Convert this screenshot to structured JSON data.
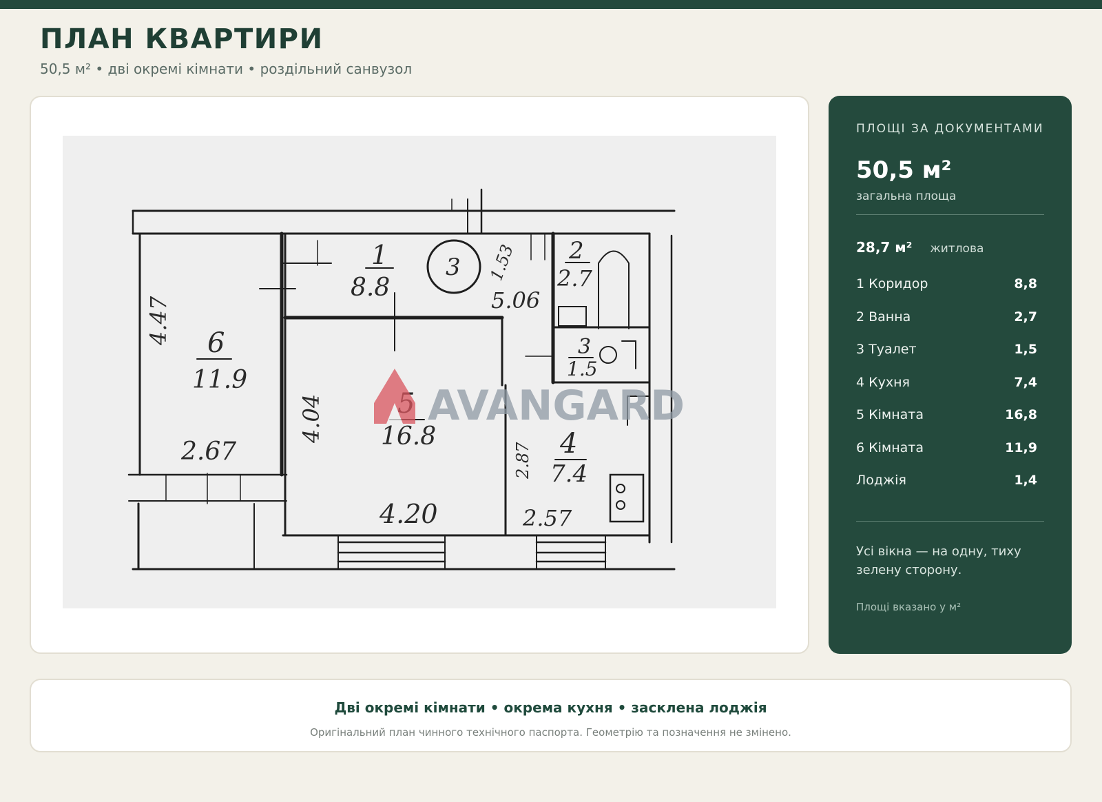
{
  "header": {
    "title": "ПЛАН КВАРТИРИ",
    "subtitle": "50,5 м² • дві окремі кімнати • роздільний санвузол"
  },
  "plan": {
    "watermark": "AVANGARD",
    "labels": {
      "room1_num": "1",
      "room1_area": "8.8",
      "room2_num": "2",
      "room2_area": "2.7",
      "room3_num": "3",
      "room3_area": "1.5",
      "room4_num": "4",
      "room4_area": "7.4",
      "room5_num": "5",
      "room5_area": "16.8",
      "room6_num": "6",
      "room6_area": "11.9",
      "circle_num": "3",
      "dim_447": "4.47",
      "dim_267": "2.67",
      "dim_404": "4.04",
      "dim_420": "4.20",
      "dim_257": "2.57",
      "dim_506": "5.06",
      "dim_153": "1.53",
      "dim_287": "2.87"
    }
  },
  "areas": {
    "label": "ПЛОЩІ ЗА ДОКУМЕНТАМИ",
    "total": "50,5 м²",
    "total_caption": "загальна площа",
    "living_value": "28,7 м²",
    "living_caption": "житлова",
    "rooms": [
      {
        "name": "1 Коридор",
        "area": "8,8"
      },
      {
        "name": "2 Ванна",
        "area": "2,7"
      },
      {
        "name": "3 Туалет",
        "area": "1,5"
      },
      {
        "name": "4 Кухня",
        "area": "7,4"
      },
      {
        "name": "5 Кімната",
        "area": "16,8"
      },
      {
        "name": "6 Кімната",
        "area": "11,9"
      },
      {
        "name": "Лоджія",
        "area": "1,4"
      }
    ],
    "note": "Усі вікна — на одну, тиху зелену сторону.",
    "unit_note": "Площі вказано у м²"
  },
  "footer": {
    "headline": "Дві окремі кімнати • окрема кухня • засклена лоджія",
    "note": "Оригінальний план чинного технічного паспорта. Геометрію та позначення не змінено."
  },
  "colors": {
    "brand_green": "#244a3d",
    "background": "#f3f1e9",
    "watermark_red": "#d9555e",
    "watermark_gray": "#8f9aa5"
  }
}
